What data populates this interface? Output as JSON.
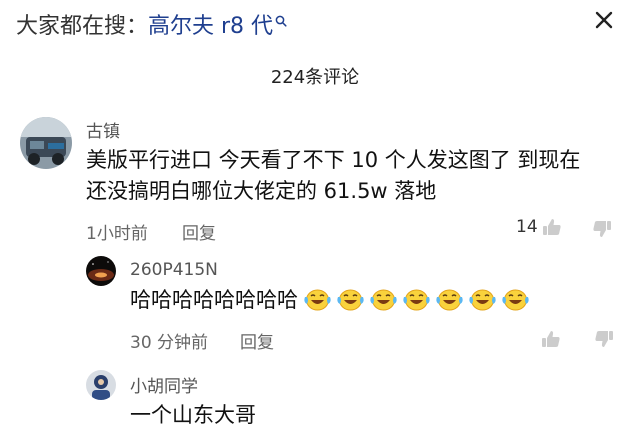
{
  "search_hint": {
    "prefix": "大家都在搜：",
    "query": "高尔夫 r8 代"
  },
  "comments_header": {
    "count_label": "224条评论"
  },
  "comments": [
    {
      "username": "古镇",
      "lines": [
        "美版平行进口 今天看了不下 10 个人发这图了 到现在",
        "还没搞明白哪位大佬定的 61.5w 落地"
      ],
      "time": "1小时前",
      "reply_label": "回复",
      "like_count": "14"
    },
    {
      "username": "260P415N",
      "text": "哈哈哈哈哈哈哈哈",
      "emoji_count": 7,
      "time": "30 分钟前",
      "reply_label": "回复"
    },
    {
      "username": "小胡同学",
      "text": "一个山东大哥"
    }
  ]
}
